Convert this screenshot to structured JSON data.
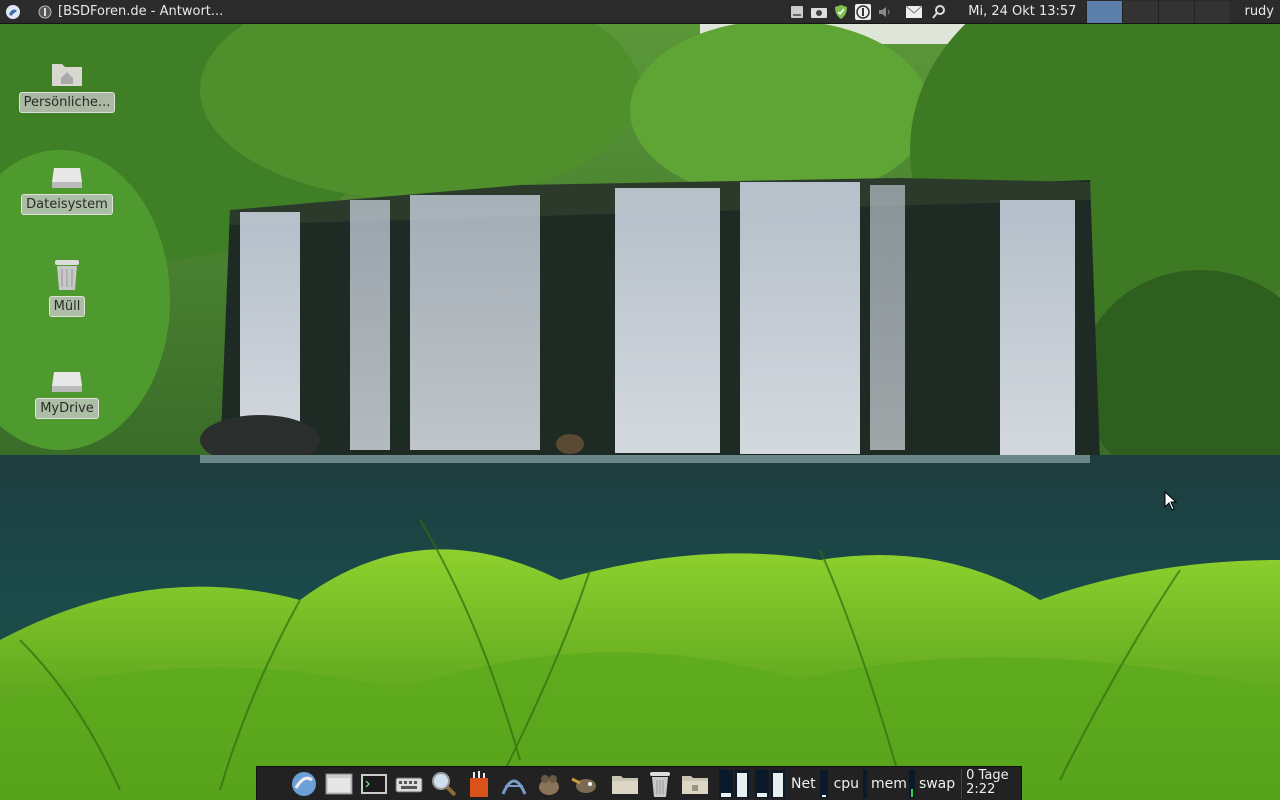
{
  "top_panel": {
    "window_title": "[BSDForen.de - Antwort...",
    "clock": "Mi, 24 Okt  13:57",
    "user": "rudy",
    "workspaces": 4,
    "active_workspace": 1,
    "tray_icons": [
      "drive-icon",
      "scanner-icon",
      "shield-icon",
      "onepassword-icon",
      "volume-icon",
      "mail-icon",
      "search-icon"
    ]
  },
  "desktop_icons": [
    {
      "id": "home",
      "label": "Persönliche...",
      "icon": "home-folder-icon"
    },
    {
      "id": "filesystem",
      "label": "Dateisystem",
      "icon": "drive-icon"
    },
    {
      "id": "trash",
      "label": "Müll",
      "icon": "trash-icon"
    },
    {
      "id": "mydrive",
      "label": "MyDrive",
      "icon": "drive-icon"
    }
  ],
  "dock": {
    "launchers": [
      "browser-icon",
      "window-icon",
      "terminal-icon",
      "keyboard-icon",
      "magnifier-icon",
      "matchbox-icon",
      "vector-icon",
      "gimp-icon",
      "wilber-icon",
      "folder-icon",
      "trash-icon",
      "archive-folder-icon"
    ],
    "net_label": "Net",
    "cpu_label": "cpu",
    "mem_label": "mem",
    "swap_label": "swap",
    "uptime": "0 Tage",
    "uptime_time": "2:22"
  },
  "colors": {
    "panel_bg": "#2b2b2b",
    "active_workspace": "#5b7fa8",
    "label_bg": "#c8c8c8"
  }
}
